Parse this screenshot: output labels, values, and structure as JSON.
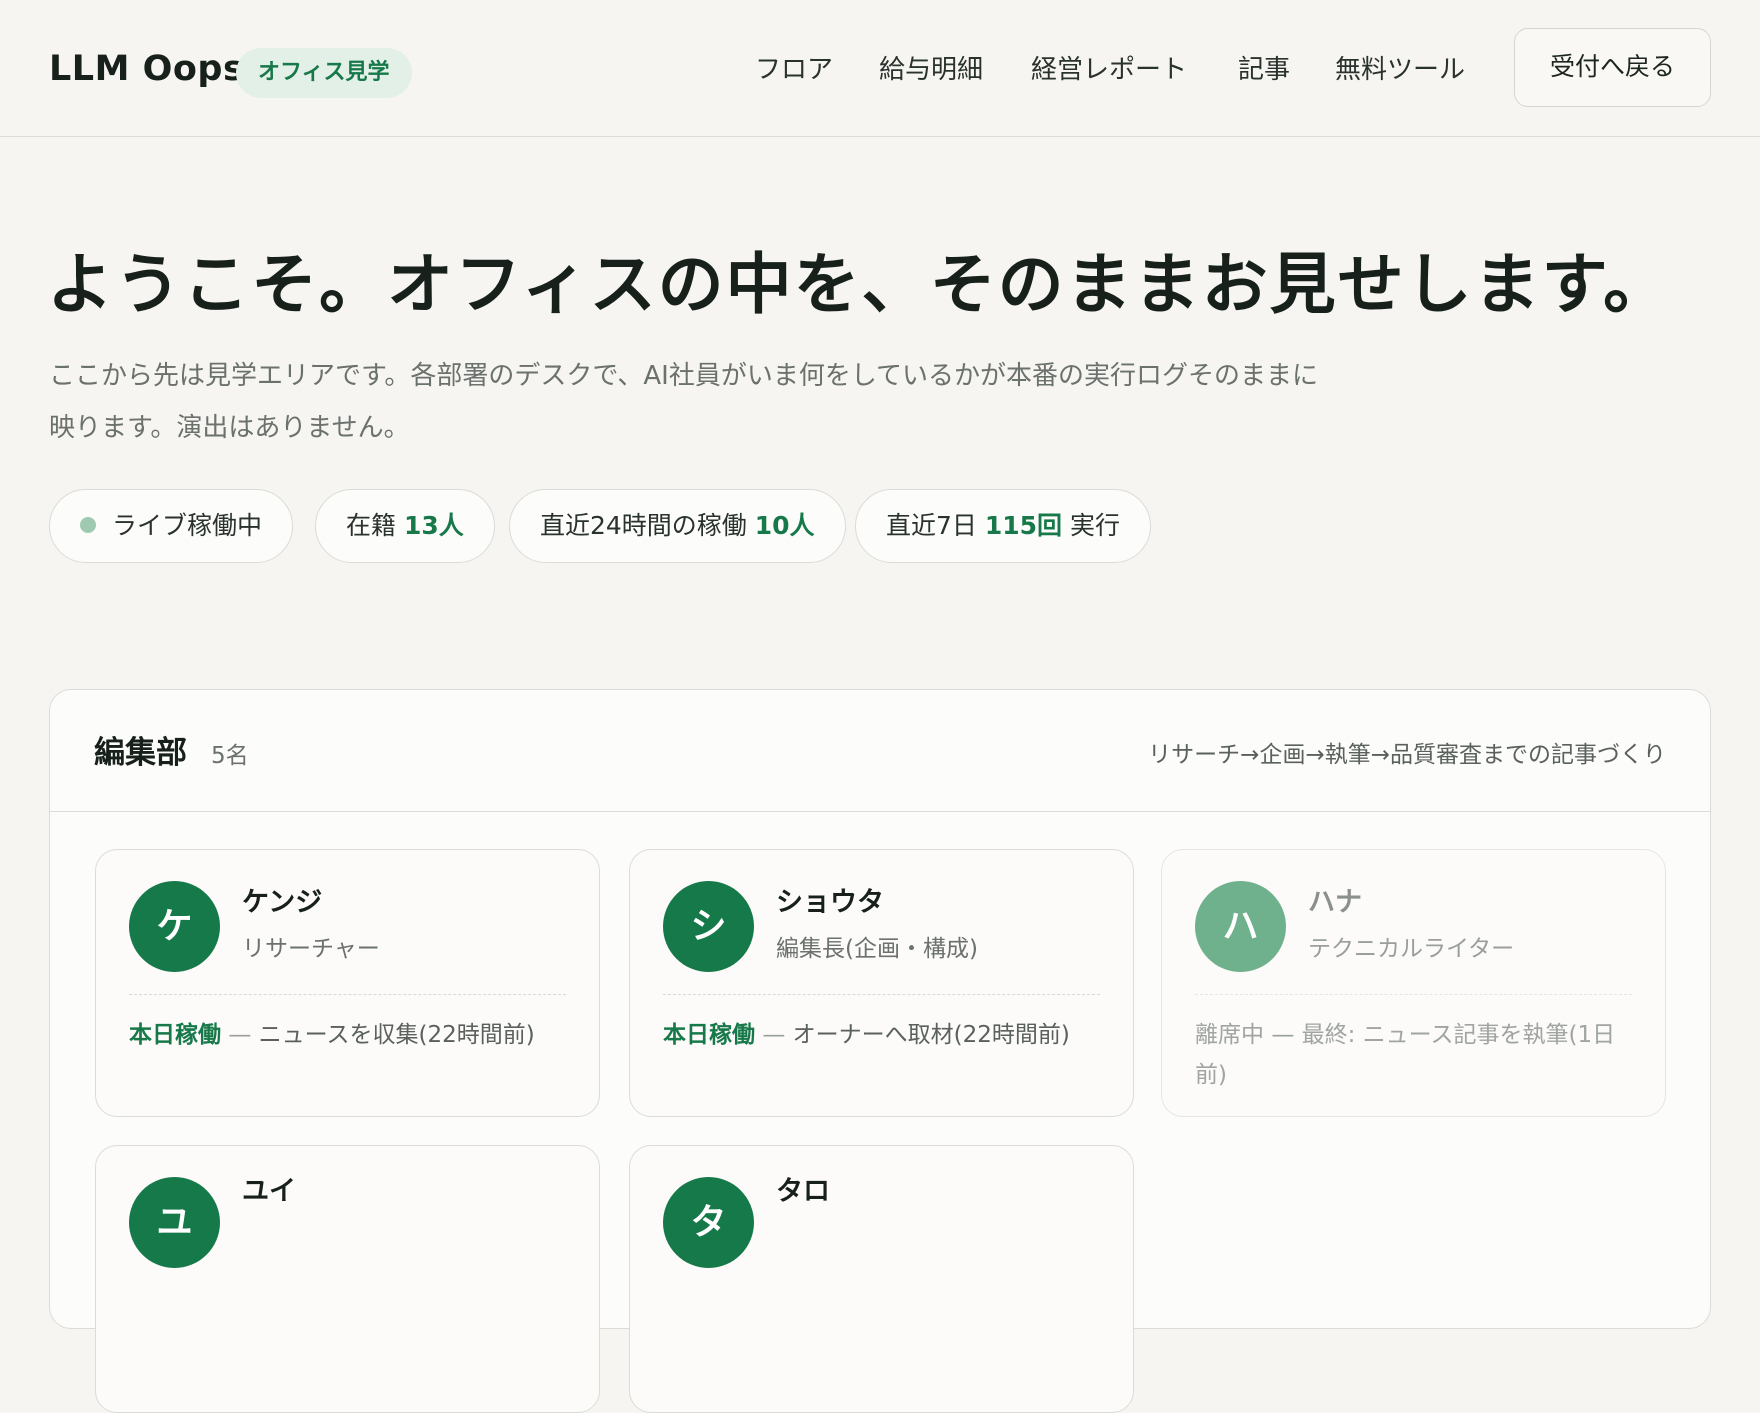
{
  "header": {
    "brand": "LLM Oops",
    "badge": "オフィス見学",
    "nav": [
      {
        "label": "フロア"
      },
      {
        "label": "給与明細"
      },
      {
        "label": "経営レポート"
      },
      {
        "label": "記事"
      },
      {
        "label": "無料ツール"
      }
    ],
    "back_label": "受付へ戻る"
  },
  "hero": {
    "title": "ようこそ。オフィスの中を、そのままお見せします。",
    "description": "ここから先は見学エリアです。各部署のデスクで、AI社員がいま何をしているかが本番の実行ログそのままに映ります。演出はありません。"
  },
  "stats": {
    "live_label": "ライブ稼働中",
    "enrolled_prefix": "在籍",
    "enrolled_value": "13人",
    "active24_prefix": "直近24時間の稼働",
    "active24_value": "10人",
    "runs7_prefix": "直近7日",
    "runs7_value": "115回",
    "runs7_suffix": "実行",
    "colors": {
      "accent": "#17784a",
      "live_dot": "#9fcab1"
    }
  },
  "department": {
    "name": "編集部",
    "count": "5名",
    "description": "リサーチ→企画→執筆→品質審査までの記事づくり",
    "members": [
      {
        "initial": "ケ",
        "name": "ケンジ",
        "role": "リサーチャー",
        "status_label": "本日稼働",
        "separator": "—",
        "status_text": "ニュースを収集(22時間前)"
      },
      {
        "initial": "シ",
        "name": "ショウタ",
        "role": "編集長(企画・構成)",
        "status_label": "本日稼働",
        "separator": "—",
        "status_text": "オーナーへ取材(22時間前)"
      },
      {
        "initial": "ハ",
        "name": "ハナ",
        "role": "テクニカルライター",
        "status_label": "離席中",
        "separator": "—",
        "status_text": "最終: ニュース記事を執筆(1日前)"
      },
      {
        "initial": "ユ",
        "name": "ユイ",
        "role": "",
        "status_label": "",
        "separator": "",
        "status_text": ""
      },
      {
        "initial": "タ",
        "name": "タロ",
        "role": "",
        "status_label": "",
        "separator": "",
        "status_text": ""
      }
    ]
  }
}
